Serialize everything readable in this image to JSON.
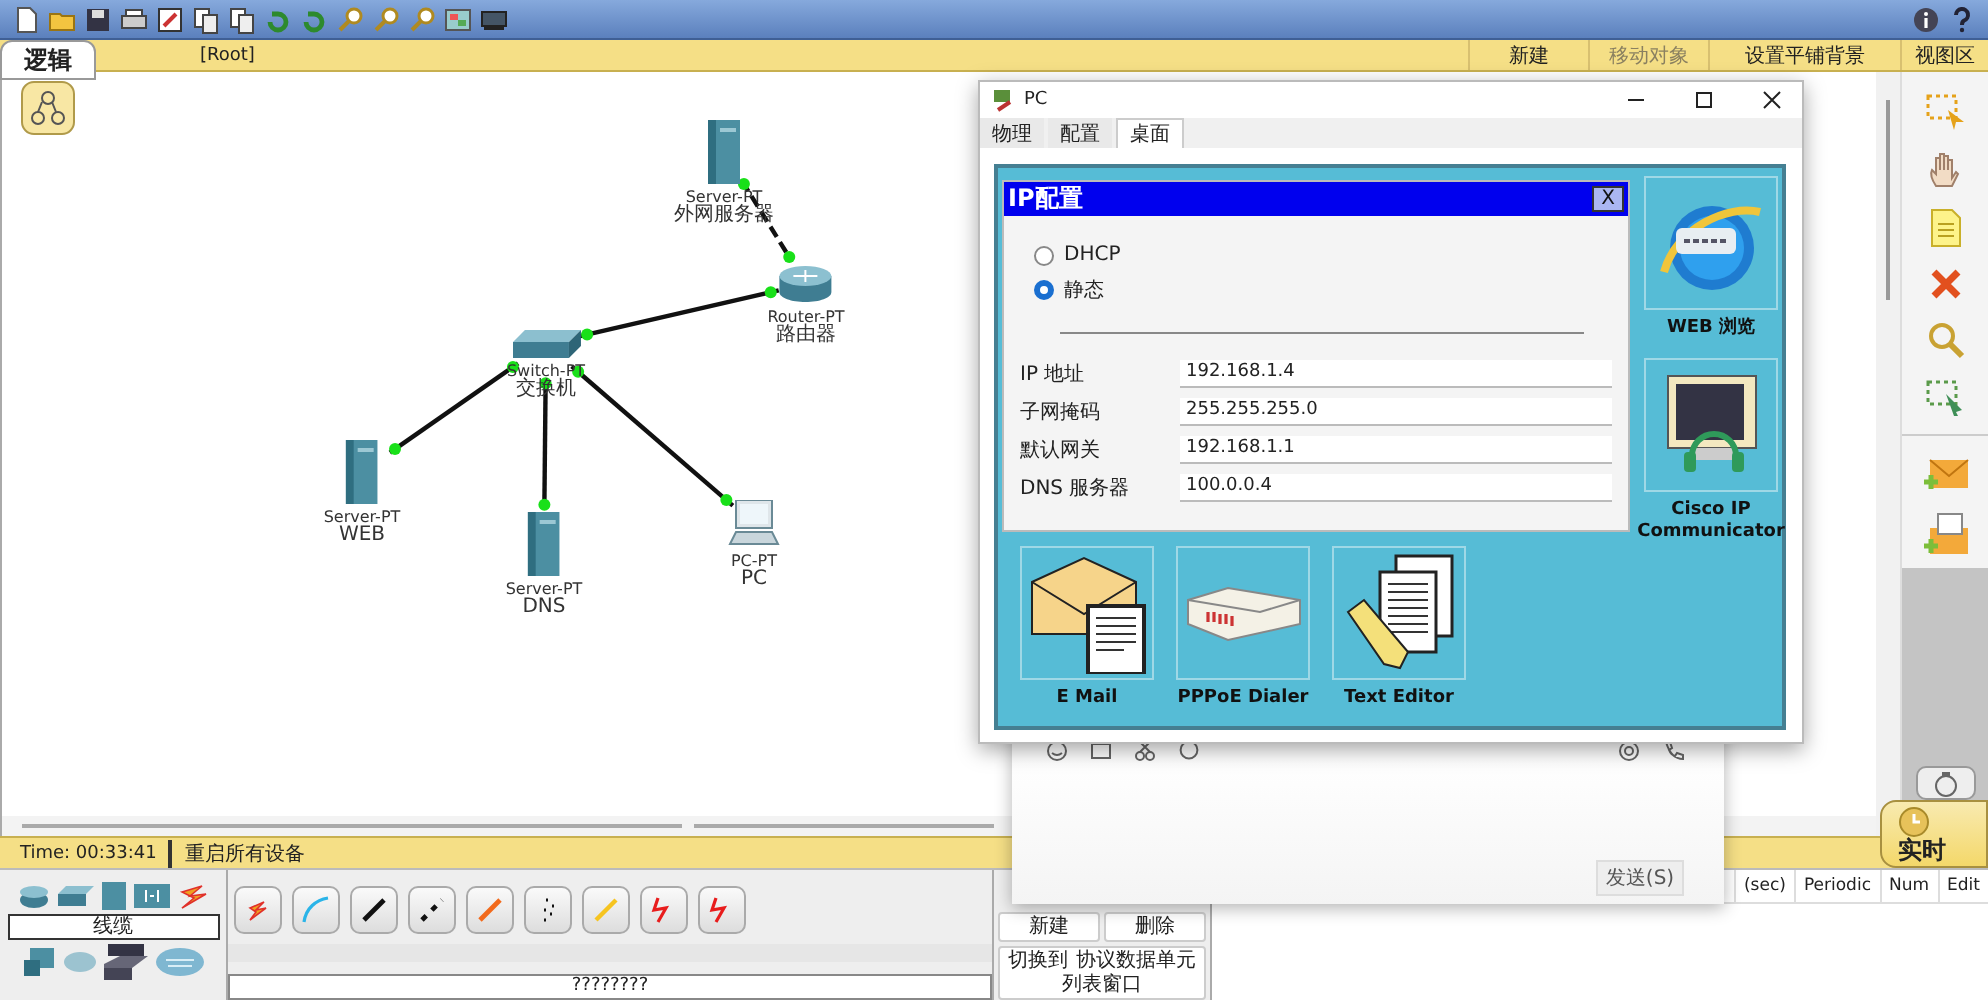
{
  "workspace_tab": {
    "label": "逻辑"
  },
  "breadcrumb": "[Root]",
  "top_actions": [
    {
      "label": "新建",
      "disabled": false
    },
    {
      "label": "移动对象",
      "disabled": true
    },
    {
      "label": "设置平铺背景",
      "disabled": false
    },
    {
      "label": "视图区",
      "disabled": false
    }
  ],
  "topology": {
    "devices": [
      {
        "kind": "server",
        "model": "Server-PT",
        "name": "外网服务器"
      },
      {
        "kind": "router",
        "model": "Router-PT",
        "name": "路由器"
      },
      {
        "kind": "switch",
        "model": "Switch-PT",
        "name": "交换机"
      },
      {
        "kind": "server",
        "model": "Server-PT",
        "name": "WEB"
      },
      {
        "kind": "server",
        "model": "Server-PT",
        "name": "DNS"
      },
      {
        "kind": "pc",
        "model": "PC-PT",
        "name": "PC"
      }
    ]
  },
  "pc_window": {
    "title": "PC",
    "tabs": [
      {
        "label": "物理",
        "selected": false
      },
      {
        "label": "配置",
        "selected": false
      },
      {
        "label": "桌面",
        "selected": true
      }
    ],
    "ip_config": {
      "title": "IP配置",
      "close": "X",
      "modes": [
        {
          "label": "DHCP",
          "selected": false
        },
        {
          "label": "静态",
          "selected": true
        }
      ],
      "fields": [
        {
          "label": "IP 地址",
          "value": "192.168.1.4"
        },
        {
          "label": "子网掩码",
          "value": "255.255.255.0"
        },
        {
          "label": "默认网关",
          "value": "192.168.1.1"
        },
        {
          "label": "DNS 服务器",
          "value": "100.0.0.4"
        }
      ]
    },
    "apps": [
      {
        "kind": "browser",
        "label": "WEB 浏览"
      },
      {
        "kind": "ip-phone",
        "label": "Cisco IP Communicator"
      },
      {
        "kind": "mail",
        "label": "E Mail"
      },
      {
        "kind": "dialer",
        "label": "PPPoE Dialer"
      },
      {
        "kind": "editor",
        "label": "Text Editor"
      }
    ]
  },
  "chat_window": {
    "send_button": "发送(S)"
  },
  "status_bar": {
    "time": "Time: 00:33:41",
    "action": "重启所有设备"
  },
  "mode_tab": {
    "label": "实时"
  },
  "device_panel": {
    "category": "线缆",
    "cable_type": "????????"
  },
  "scenario": {
    "buttons": [
      "新建",
      "删除"
    ],
    "switch_button": [
      "切换到",
      "协议数据单元",
      "列表窗口"
    ]
  },
  "pdu_table": {
    "columns": [
      "(sec)",
      "Periodic",
      "Num",
      "Edit"
    ]
  }
}
